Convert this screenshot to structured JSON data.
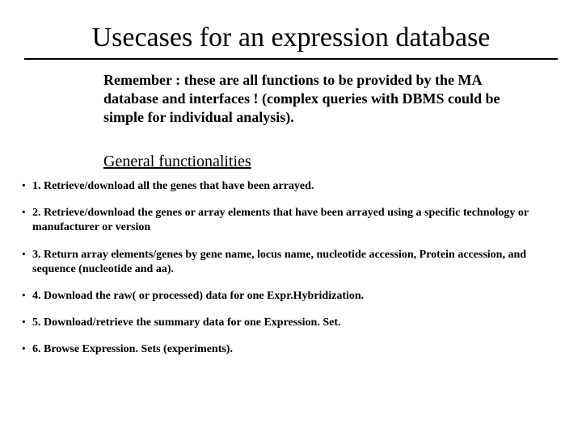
{
  "title": "Usecases for an expression database",
  "intro": "Remember : these are all functions to be provided by the MA database and interfaces ! (complex queries with DBMS could be simple for individual analysis).",
  "subhead": "General functionalities",
  "bullet": "·",
  "items": [
    "1. Retrieve/download all the genes that have been arrayed.",
    "2. Retrieve/download the genes or array elements that have been arrayed using a specific technology or manufacturer or version",
    "3. Return array elements/genes by gene name, locus name, nucleotide accession, Protein accession, and sequence (nucleotide and aa).",
    "4. Download the raw( or processed) data for one Expr.Hybridization.",
    "5. Download/retrieve the summary data for one Expression. Set.",
    "6. Browse Expression. Sets (experiments)."
  ]
}
